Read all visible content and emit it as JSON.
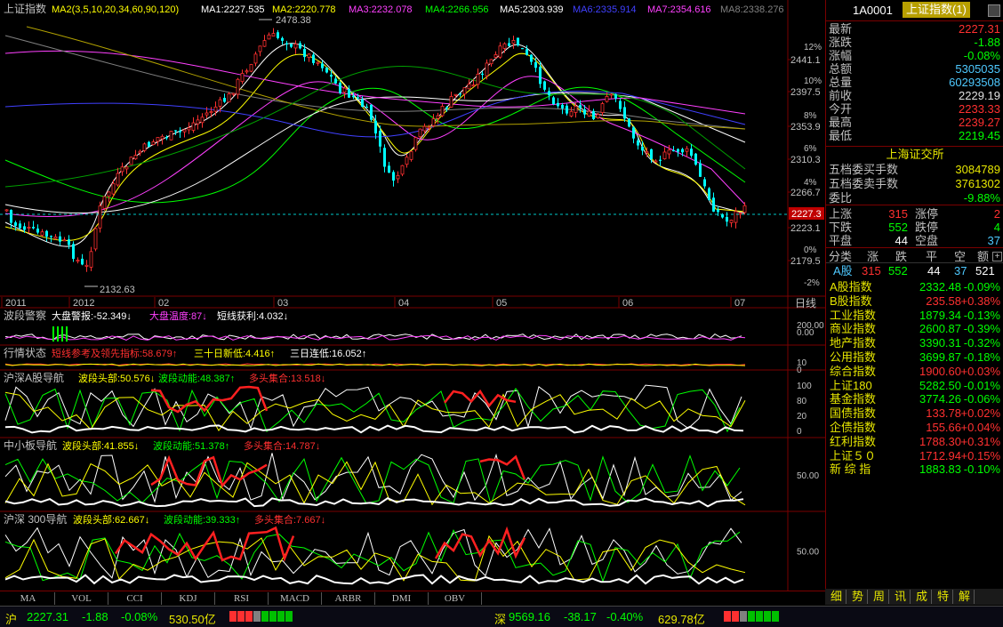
{
  "main": {
    "title": "上证指数",
    "ma_labels": [
      {
        "text": "MA2(3,5,10,20,34,60,90,120)",
        "color": "#ffff00"
      },
      {
        "text": "MA1:2227.535",
        "color": "#ffffff"
      },
      {
        "text": "MA2:2220.778",
        "color": "#ffff00"
      },
      {
        "text": "MA3:2232.078",
        "color": "#ff40ff"
      },
      {
        "text": "MA4:2266.956",
        "color": "#00ff00"
      },
      {
        "text": "MA5:2303.939",
        "color": "#ffffff"
      },
      {
        "text": "MA6:2335.914",
        "color": "#4040ff"
      },
      {
        "text": "MA7:2354.616",
        "color": "#ff40ff"
      },
      {
        "text": "MA8:2338.276",
        "color": "#808080"
      }
    ],
    "arrow_up": "↑",
    "axis_prices": [
      "2441.1",
      "2397.5",
      "2353.9",
      "2310.3",
      "2266.7",
      "2223.1",
      "2179.5"
    ],
    "axis_pct": [
      "12%",
      "10%",
      "8%",
      "6%",
      "4%",
      "2%",
      "0%",
      "-2%"
    ],
    "current_price_tag": "2227.3",
    "high_label": "2478.38",
    "low_label": "2132.63",
    "date_labels": [
      "2011",
      "2012",
      "02",
      "03",
      "04",
      "05",
      "06",
      "07"
    ],
    "period": "日线"
  },
  "panels": [
    {
      "id": "bdjc",
      "title": "波段警察",
      "items": [
        {
          "text": "大盘警报:-52.349↓",
          "color": "#ffffff"
        },
        {
          "text": "大盘温度:87↓",
          "color": "#ff40ff"
        },
        {
          "text": "短线获利:4.032↓",
          "color": "#ffffff"
        }
      ],
      "axis": [
        "200.00",
        "0.00"
      ]
    },
    {
      "id": "hqzt",
      "title": "行情状态",
      "items": [
        {
          "text": "短线参考及领先指标:58.679↑",
          "color": "#ff3030"
        },
        {
          "text": "三十日新低:4.416↑",
          "color": "#ffff00"
        },
        {
          "text": "三日连低:16.052↑",
          "color": "#ffffff"
        }
      ],
      "axis": [
        "10",
        "0"
      ]
    },
    {
      "id": "hs_a",
      "title": "沪深A股导航",
      "items": [
        {
          "text": "波段头部:50.576↓",
          "color": "#ffff00"
        },
        {
          "text": "波段动能:48.387↑",
          "color": "#00ff00"
        },
        {
          "text": "多头集合:13.518↓",
          "color": "#ff3030"
        }
      ],
      "axis": [
        "100",
        "80",
        "20",
        "0"
      ]
    },
    {
      "id": "zxb",
      "title": "中小板导航",
      "items": [
        {
          "text": "波段头部:41.855↓",
          "color": "#ffff00"
        },
        {
          "text": "波段动能:51.378↑",
          "color": "#00ff00"
        },
        {
          "text": "多头集合:14.787↓",
          "color": "#ff3030"
        }
      ],
      "axis": [
        "50.00"
      ]
    },
    {
      "id": "hs300",
      "title": "沪深 300导航",
      "items": [
        {
          "text": "波段头部:62.667↓",
          "color": "#ffff00"
        },
        {
          "text": "波段动能:39.333↑",
          "color": "#00ff00"
        },
        {
          "text": "多头集合:7.667↓",
          "color": "#ff3030"
        }
      ],
      "axis": [
        "50.00"
      ]
    }
  ],
  "side": {
    "code": "1A0001",
    "name": "上证指数(1)",
    "quote": [
      {
        "label": "最新",
        "value": "2227.31",
        "color": "#ff3030"
      },
      {
        "label": "涨跌",
        "value": "-1.88",
        "color": "#00ff00"
      },
      {
        "label": "涨幅",
        "value": "-0.08%",
        "color": "#00ff00"
      },
      {
        "label": "总额",
        "value": "5305035",
        "color": "#4ec9ff"
      },
      {
        "label": "总量",
        "value": "60293508",
        "color": "#4ec9ff"
      },
      {
        "label": "前收",
        "value": "2229.19",
        "color": "#e0e0e0"
      },
      {
        "label": "今开",
        "value": "2233.33",
        "color": "#ff3030"
      },
      {
        "label": "最高",
        "value": "2239.27",
        "color": "#ff3030"
      },
      {
        "label": "最低",
        "value": "2219.45",
        "color": "#00ff00"
      }
    ],
    "exchange": "上海证交所",
    "order_book": [
      {
        "label": "五档委买手数",
        "value": "3084789",
        "color": "#e6e600"
      },
      {
        "label": "五档委卖手数",
        "value": "3761302",
        "color": "#e6e600"
      },
      {
        "label": "委比",
        "value": "-9.88%",
        "color": "#00ff00"
      }
    ],
    "breadth": [
      {
        "l1": "上涨",
        "v1": "315",
        "c1": "#ff3030",
        "l2": "涨停",
        "v2": "2",
        "c2": "#ff3030"
      },
      {
        "l1": "下跌",
        "v1": "552",
        "c1": "#00ff00",
        "l2": "跌停",
        "v2": "4",
        "c2": "#00ff00"
      },
      {
        "l1": "平盘",
        "v1": "44",
        "c1": "#ffffff",
        "l2": "空盘",
        "v2": "37",
        "c2": "#4ec9ff"
      }
    ],
    "class_header": [
      "分类",
      "涨",
      "跌",
      "平",
      "空",
      "额"
    ],
    "class_row": {
      "name": "A股",
      "up": "315",
      "down": "552",
      "flat": "44",
      "empty": "37",
      "amount": "521"
    },
    "indices": [
      {
        "name": "A股指数",
        "price": "2332.48",
        "chg": "-0.09%",
        "color": "#00ff00"
      },
      {
        "name": "B股指数",
        "price": "235.58",
        "chg": "+0.38%",
        "color": "#ff3030"
      },
      {
        "name": "工业指数",
        "price": "1879.34",
        "chg": "-0.13%",
        "color": "#00ff00"
      },
      {
        "name": "商业指数",
        "price": "2600.87",
        "chg": "-0.39%",
        "color": "#00ff00"
      },
      {
        "name": "地产指数",
        "price": "3390.31",
        "chg": "-0.32%",
        "color": "#00ff00"
      },
      {
        "name": "公用指数",
        "price": "3699.87",
        "chg": "-0.18%",
        "color": "#00ff00"
      },
      {
        "name": "综合指数",
        "price": "1900.60",
        "chg": "+0.03%",
        "color": "#ff3030"
      },
      {
        "name": "上证180",
        "price": "5282.50",
        "chg": "-0.01%",
        "color": "#00ff00"
      },
      {
        "name": "基金指数",
        "price": "3774.26",
        "chg": "-0.06%",
        "color": "#00ff00"
      },
      {
        "name": "国债指数",
        "price": "133.78",
        "chg": "+0.02%",
        "color": "#ff3030"
      },
      {
        "name": "企债指数",
        "price": "155.66",
        "chg": "+0.04%",
        "color": "#ff3030"
      },
      {
        "name": "红利指数",
        "price": "1788.30",
        "chg": "+0.31%",
        "color": "#ff3030"
      },
      {
        "name": "上证５０",
        "price": "1712.94",
        "chg": "+0.15%",
        "color": "#ff3030"
      },
      {
        "name": "新 综 指",
        "price": "1883.83",
        "chg": "-0.10%",
        "color": "#00ff00"
      }
    ],
    "tabs": [
      "细",
      "势",
      "周",
      "讯",
      "成",
      "特",
      "解"
    ]
  },
  "tabbar": [
    "MA",
    "VOL",
    "CCI",
    "KDJ",
    "RSI",
    "MACD",
    "ARBR",
    "DMI",
    "OBV"
  ],
  "status": {
    "sh_label": "沪",
    "sh_price": "2227.31",
    "sh_chg": "-1.88",
    "sh_pct": "-0.08%",
    "sh_amount": "530.50亿",
    "sz_label": "深",
    "sz_price": "9569.16",
    "sz_chg": "-38.17",
    "sz_pct": "-0.40%",
    "sz_amount": "629.78亿"
  },
  "colors": {
    "up": "#ff3030",
    "down": "#00ffff",
    "accent": "#e6e600",
    "grid": "#7a0000"
  }
}
